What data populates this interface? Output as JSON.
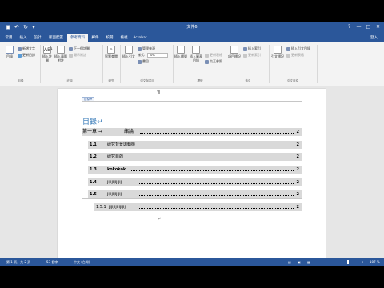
{
  "window": {
    "title": "文件6",
    "buttons": [
      "?",
      "—",
      "□",
      "✕"
    ]
  },
  "quick_access": {
    "save_icon": "save-icon",
    "undo_icon": "undo-icon",
    "redo_icon": "redo-icon",
    "customize_icon": "dropdown-icon"
  },
  "tabs": [
    "常用",
    "插入",
    "設計",
    "版面配置",
    "參考資料",
    "郵件",
    "校閱",
    "檢視",
    "Acrobat"
  ],
  "active_tab": "參考資料",
  "user_name": "登入",
  "ribbon": {
    "toc": {
      "label": "目錄",
      "add_text": "新增文字",
      "update_table": "更新目錄",
      "group": "目錄"
    },
    "footnotes": {
      "insert": "插入註腳",
      "insert_endnote": "插入章節附註",
      "next": "下一個註腳",
      "show": "顯示附註",
      "group": "註腳"
    },
    "research": {
      "smart_lookup": "智慧查閱",
      "group": "研究"
    },
    "citations": {
      "insert": "插入引文",
      "manage": "管理來源",
      "style_label": "樣式:",
      "style_value": "APA",
      "bibliography": "書目",
      "group": "引文與書目"
    },
    "captions": {
      "insert": "插入標號",
      "insert_tof": "插入圖表目錄",
      "update": "更新表格",
      "cross_ref": "交互參照",
      "group": "標號"
    },
    "index": {
      "mark": "項目標記",
      "insert": "插入索引",
      "update": "更新索引",
      "group": "索引"
    },
    "authorities": {
      "mark": "引文標記",
      "insert": "插入引文目錄",
      "update": "更新表格",
      "group": "引文目錄"
    }
  },
  "document": {
    "mark_top": "¶",
    "mark_bottom": "↵",
    "toc_tab_label": "目錄 ▾",
    "toc_title": "目錄↵",
    "entries": [
      {
        "level": 1,
        "num": "第一章 →",
        "text": "緒論",
        "page": "2"
      },
      {
        "level": 2,
        "num": "1.1",
        "text": "研究背景與動機",
        "page": "2"
      },
      {
        "level": 2,
        "num": "1.2",
        "text": "研究目的",
        "page": "2"
      },
      {
        "level": 2,
        "num": "1.3",
        "text": "kokokok",
        "page": "2"
      },
      {
        "level": 2,
        "num": "1.4",
        "text": "jijijijijijiji",
        "page": "2"
      },
      {
        "level": 2,
        "num": "1.5",
        "text": "jijijijijijiji",
        "page": "2"
      },
      {
        "level": 3,
        "num": "1.5.1",
        "text": "jijijijijijijiji",
        "page": "2"
      }
    ]
  },
  "status": {
    "page": "第 1 頁，共 2 頁",
    "words": "53 個字",
    "language": "中文 (台灣)",
    "zoom": "107 %",
    "zoom_level": 0.62
  },
  "colors": {
    "accent": "#2b579a",
    "toc_heading": "#2e74b5",
    "field_shading": "#d9d9d9"
  }
}
